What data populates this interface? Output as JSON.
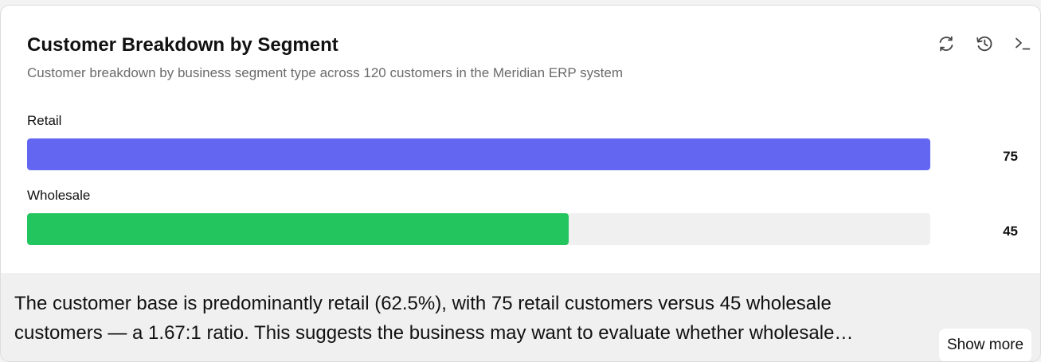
{
  "card": {
    "title": "Customer Breakdown by Segment",
    "subtitle": "Customer breakdown by business segment type across 120 customers in the Meridian ERP system"
  },
  "toolbar": {
    "refresh_icon": "refresh-icon",
    "history_icon": "history-icon",
    "terminal_icon": "terminal-icon"
  },
  "chart_data": {
    "type": "bar",
    "orientation": "horizontal",
    "categories": [
      "Retail",
      "Wholesale"
    ],
    "values": [
      75,
      45
    ],
    "value_labels": [
      "75",
      "45"
    ],
    "xlim": [
      0,
      75
    ],
    "colors": [
      "#6366f1",
      "#22c55e"
    ],
    "track_color": "#f0f0f0"
  },
  "summary": {
    "text": "The customer base is predominantly retail (62.5%), with 75 retail customers versus 45 wholesale customers — a 1.67:1 ratio. This suggests the business may want to evaluate whether wholesale…",
    "show_more_label": "Show more"
  }
}
